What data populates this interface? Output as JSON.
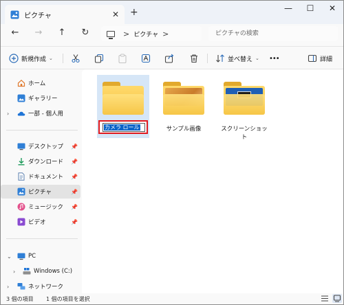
{
  "window": {
    "tab_title": "ピクチャ",
    "tab_close": "✕",
    "new_tab": "+",
    "minimize": "—",
    "maximize": "☐",
    "close": "✕"
  },
  "navbar": {
    "back": "←",
    "forward": "→",
    "up": "↑",
    "refresh": "↻",
    "breadcrumb": [
      "ピクチャ"
    ],
    "crumb_sep": ">",
    "search_placeholder": "ピクチャの検索"
  },
  "commandbar": {
    "new_label": "新規作成",
    "sort_label": "並べ替え",
    "more": "•••",
    "details_label": "詳細"
  },
  "sidebar": {
    "items": [
      {
        "label": "ホーム",
        "icon": "home-icon"
      },
      {
        "label": "ギャラリー",
        "icon": "gallery-icon"
      },
      {
        "label": "一部 - 個人用",
        "icon": "onedrive-icon"
      },
      {
        "label": "デスクトップ",
        "icon": "desktop-icon"
      },
      {
        "label": "ダウンロード",
        "icon": "download-icon"
      },
      {
        "label": "ドキュメント",
        "icon": "document-icon"
      },
      {
        "label": "ピクチャ",
        "icon": "pictures-icon"
      },
      {
        "label": "ミュージック",
        "icon": "music-icon"
      },
      {
        "label": "ビデオ",
        "icon": "video-icon"
      },
      {
        "label": "PC",
        "icon": "pc-icon"
      },
      {
        "label": "Windows (C:)",
        "icon": "drive-icon"
      },
      {
        "label": "ネットワーク",
        "icon": "network-icon"
      }
    ]
  },
  "content": {
    "folders": [
      {
        "label": "カメラ ロール",
        "renaming": true
      },
      {
        "label": "サンプル画像"
      },
      {
        "label": "スクリーンショット"
      }
    ]
  },
  "status": {
    "count": "3 個の項目",
    "selected": "1 個の項目を選択"
  },
  "colors": {
    "accent": "#0a64c8",
    "highlight_border": "#e0191e",
    "folder": "#f5c443"
  }
}
